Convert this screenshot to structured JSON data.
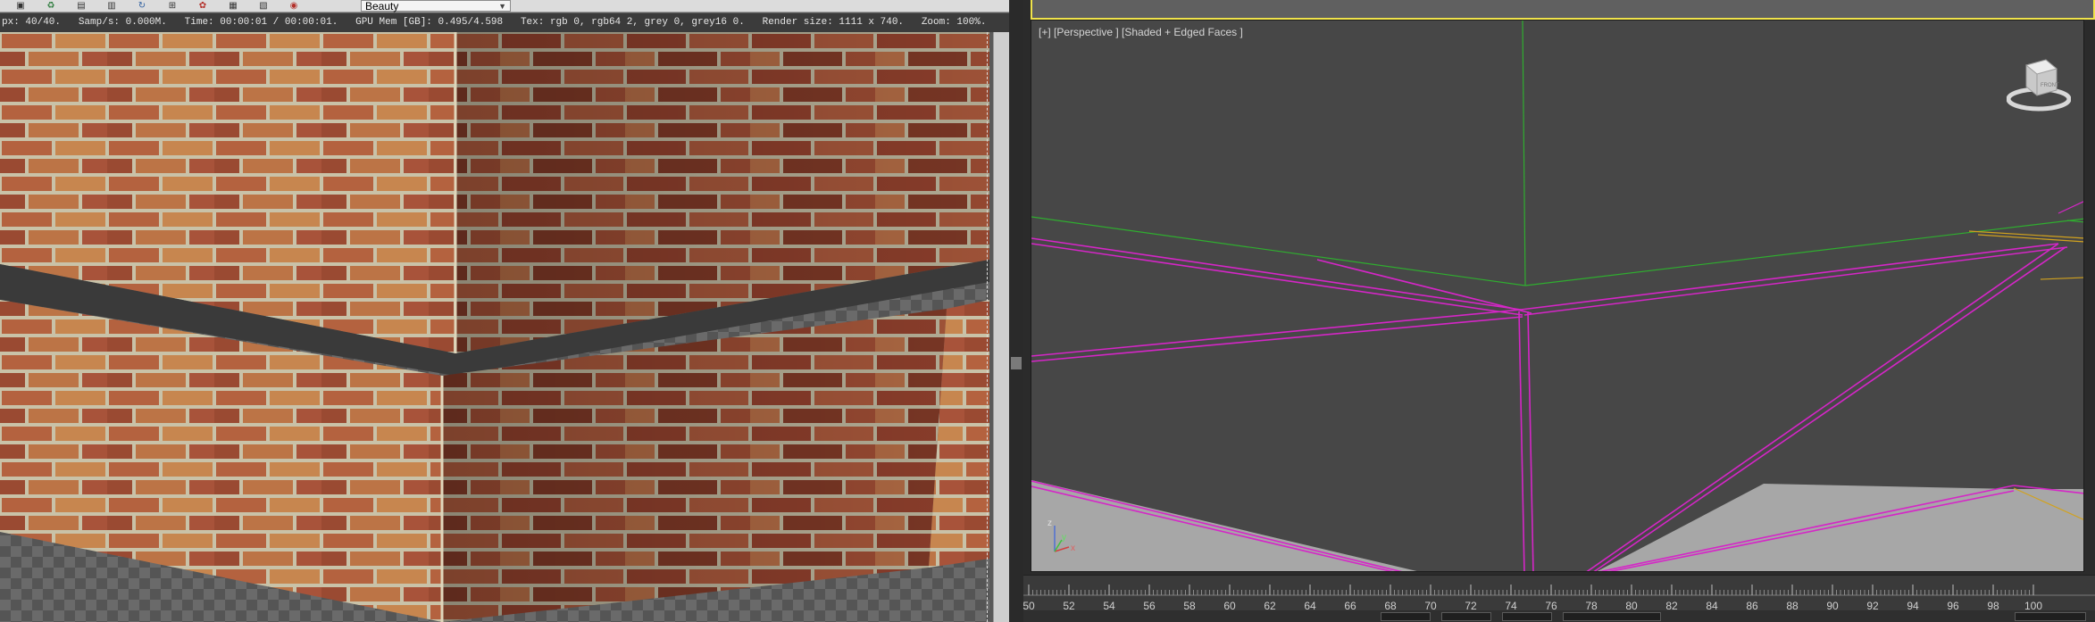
{
  "render_frame": {
    "channel": "Beauty",
    "stats": {
      "passes": "px: 40/40",
      "samples": "Samp/s: 0.000M",
      "time": "Time: 00:00:01 / 00:00:01",
      "gpu_mem": "GPU Mem [GB]: 0.495/4.598",
      "tex": "Tex: rgb 0, rgb64 2, grey 0, grey16 0",
      "render_size": "Render size: 1111 x 740",
      "zoom": "Zoom: 100%"
    },
    "toolbar_icons": [
      "save-icon",
      "copy-icon",
      "clone-icon",
      "print-icon",
      "clear-icon",
      "open-icon",
      "render-icon",
      "channel-icon",
      "display-icon",
      "setup-icon",
      "lut-icon"
    ],
    "colors": {
      "brick": "#a8533a",
      "brick_light": "#c88a55",
      "mortar": "#c9c2a8"
    }
  },
  "viewport": {
    "label": "[+] [Perspective ] [Shaded + Edged Faces ]",
    "axis": {
      "x": "x",
      "y": "y",
      "z": "z"
    },
    "viewcube_label": "FRONT",
    "colors": {
      "selection": "#d526c7",
      "green_edge": "#2fae2f",
      "active_border": "#f0e34a",
      "floor": "#a7a7a7"
    }
  },
  "timeline": {
    "ticks": [
      "50",
      "52",
      "54",
      "56",
      "58",
      "60",
      "62",
      "64",
      "66",
      "68",
      "70",
      "72",
      "74",
      "76",
      "78",
      "80",
      "82",
      "84",
      "86",
      "88",
      "90",
      "92",
      "94",
      "96",
      "98",
      "100"
    ]
  }
}
